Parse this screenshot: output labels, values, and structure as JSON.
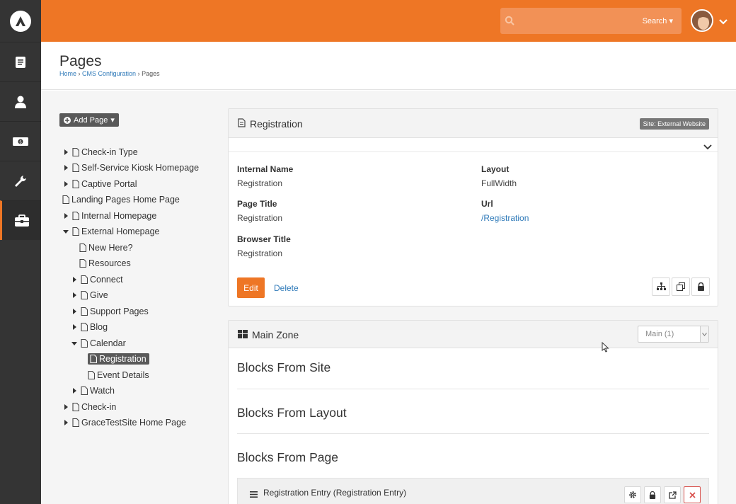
{
  "search": {
    "placeholder": "",
    "button_label": "Search"
  },
  "header": {
    "title": "Pages",
    "breadcrumbs": [
      "Home",
      "CMS Configuration",
      "Pages"
    ]
  },
  "tree": {
    "add_button": "Add Page",
    "items": [
      {
        "label": "Check-in Type",
        "state": "collapsed"
      },
      {
        "label": "Self-Service Kiosk Homepage",
        "state": "collapsed"
      },
      {
        "label": "Captive Portal",
        "state": "collapsed"
      },
      {
        "label": "Landing Pages Home Page",
        "state": "leaf"
      },
      {
        "label": "Internal Homepage",
        "state": "collapsed"
      },
      {
        "label": "External Homepage",
        "state": "expanded"
      },
      {
        "label": "New Here?",
        "state": "leaf"
      },
      {
        "label": "Resources",
        "state": "leaf"
      },
      {
        "label": "Connect",
        "state": "collapsed"
      },
      {
        "label": "Give",
        "state": "collapsed"
      },
      {
        "label": "Support Pages",
        "state": "collapsed"
      },
      {
        "label": "Blog",
        "state": "collapsed"
      },
      {
        "label": "Calendar",
        "state": "expanded"
      },
      {
        "label": "Registration",
        "state": "selected"
      },
      {
        "label": "Event Details",
        "state": "leaf"
      },
      {
        "label": "Watch",
        "state": "collapsed"
      },
      {
        "label": "Check-in",
        "state": "collapsed"
      },
      {
        "label": "GraceTestSite Home Page",
        "state": "collapsed"
      }
    ]
  },
  "detail": {
    "title": "Registration",
    "site_label": "Site: External Website",
    "fields": {
      "internal_name_label": "Internal Name",
      "internal_name": "Registration",
      "layout_label": "Layout",
      "layout": "FullWidth",
      "page_title_label": "Page Title",
      "page_title": "Registration",
      "url_label": "Url",
      "url": "/Registration",
      "browser_title_label": "Browser Title",
      "browser_title": "Registration"
    },
    "edit_label": "Edit",
    "delete_label": "Delete"
  },
  "zone": {
    "title": "Main Zone",
    "select_value": "Main (1)",
    "sections": [
      "Blocks From Site",
      "Blocks From Layout",
      "Blocks From Page"
    ],
    "block": {
      "label": "Registration Entry (Registration Entry)"
    }
  },
  "colors": {
    "accent": "#ee7625",
    "nav": "#343434",
    "link": "#2f7ab9"
  }
}
